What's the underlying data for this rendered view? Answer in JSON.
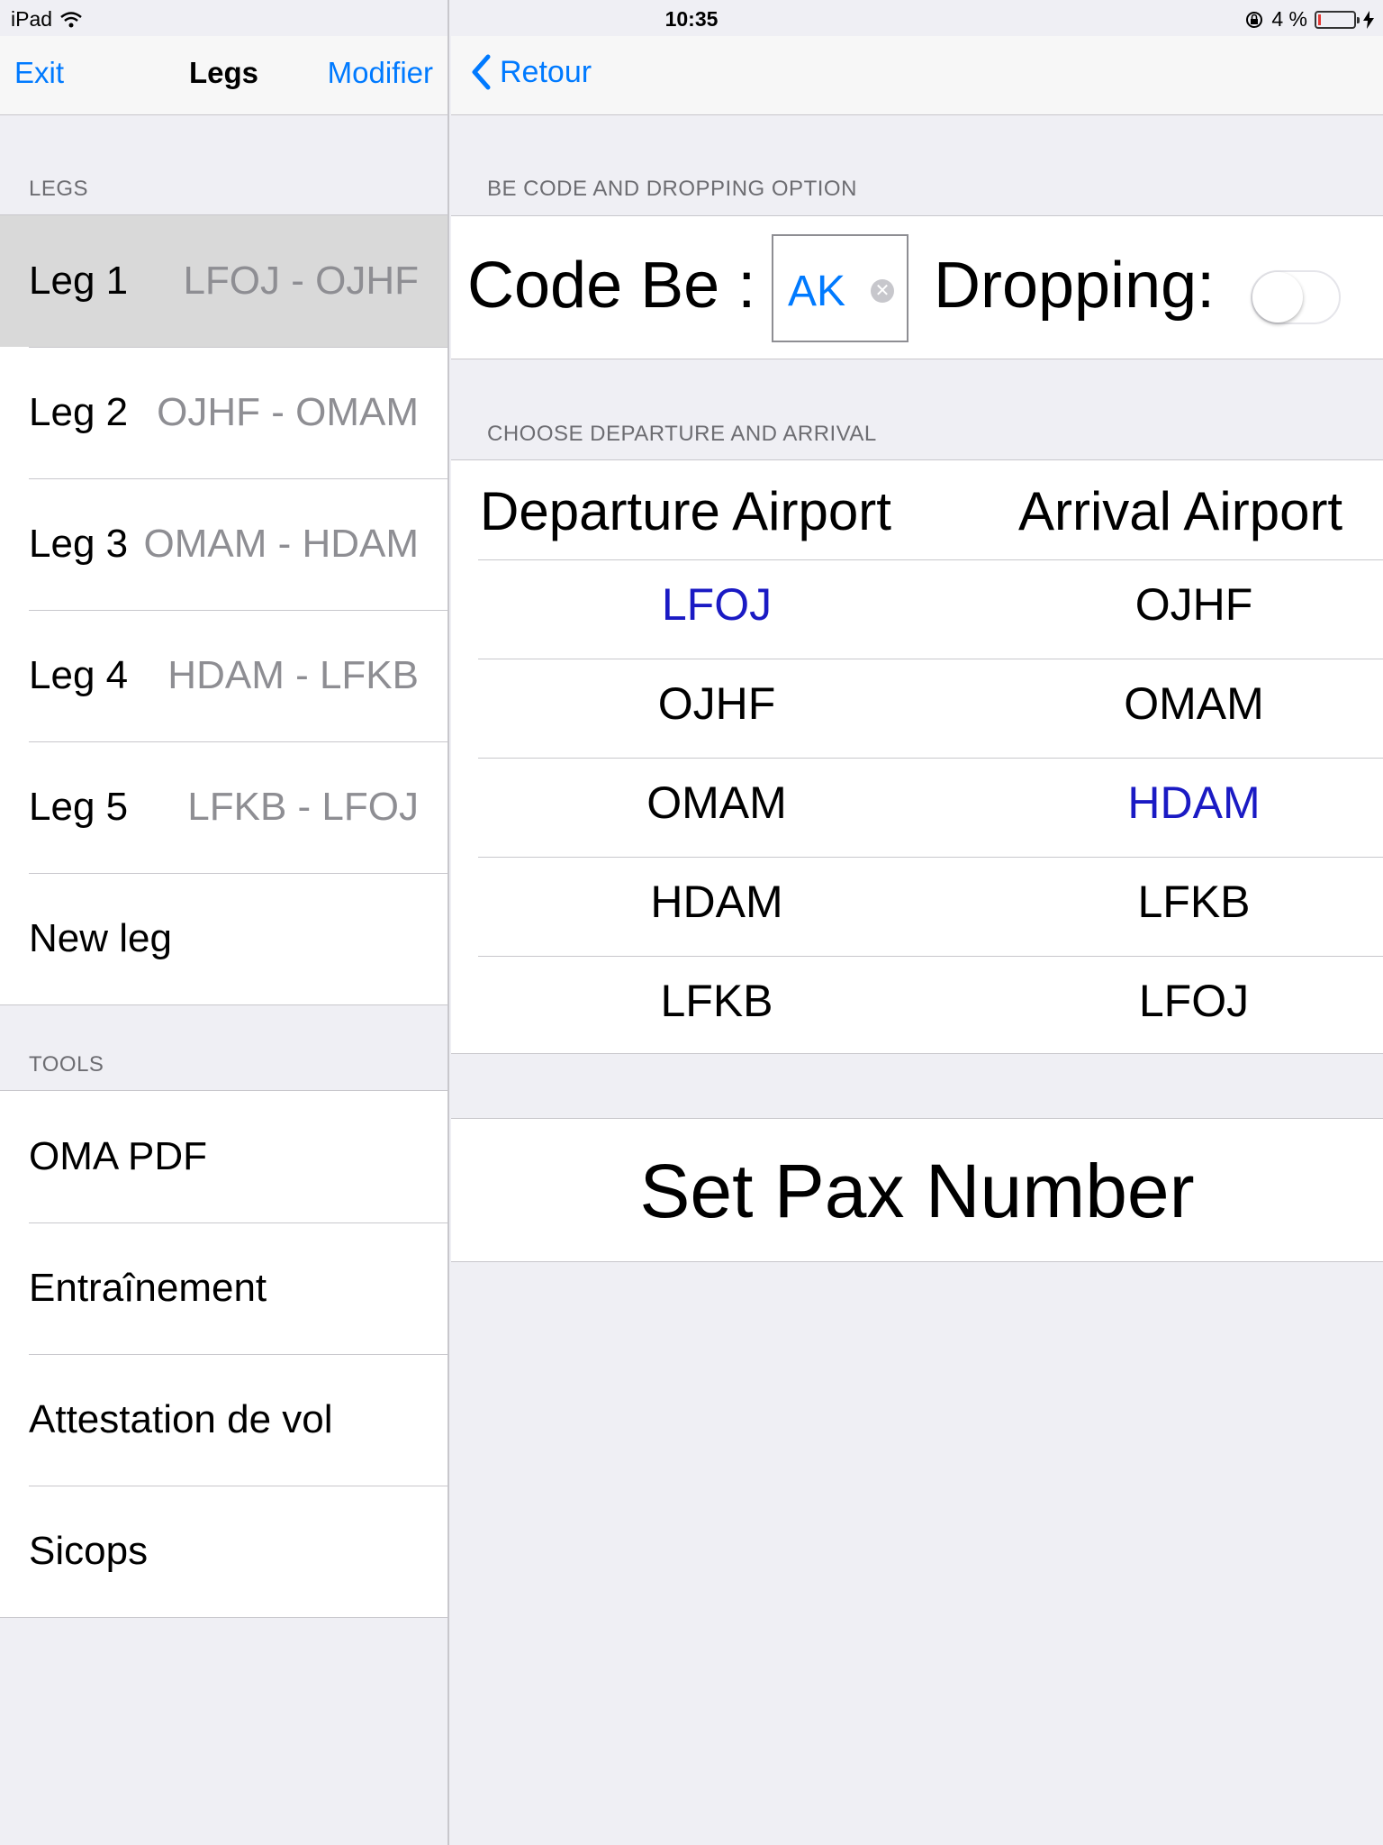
{
  "status_bar": {
    "device": "iPad",
    "time": "10:35",
    "battery_text": "4 %"
  },
  "master": {
    "nav": {
      "left_button": "Exit",
      "title": "Legs",
      "right_button": "Modifier"
    },
    "legs_header": "LEGS",
    "legs": [
      {
        "name": "Leg 1",
        "route": "LFOJ - OJHF",
        "selected": true
      },
      {
        "name": "Leg 2",
        "route": "OJHF - OMAM",
        "selected": false
      },
      {
        "name": "Leg 3",
        "route": "OMAM - HDAM",
        "selected": false
      },
      {
        "name": "Leg 4",
        "route": "HDAM - LFKB",
        "selected": false
      },
      {
        "name": "Leg 5",
        "route": "LFKB - LFOJ",
        "selected": false
      }
    ],
    "new_leg": "New leg",
    "tools_header": "TOOLS",
    "tools": [
      "OMA PDF",
      "Entraînement",
      "Attestation de vol",
      "Sicops"
    ]
  },
  "detail": {
    "nav": {
      "back_button": "Retour"
    },
    "be_section_header": "BE CODE AND DROPPING OPTION",
    "code_be_label": "Code Be :",
    "code_be_value": "AK",
    "dropping_label": "Dropping:",
    "dropping_on": false,
    "airports_section_header": "CHOOSE DEPARTURE AND ARRIVAL",
    "departure_header": "Departure Airport",
    "arrival_header": "Arrival Airport",
    "airport_rows": [
      {
        "departure": "LFOJ",
        "arrival": "OJHF"
      },
      {
        "departure": "OJHF",
        "arrival": "OMAM"
      },
      {
        "departure": "OMAM",
        "arrival": "HDAM"
      },
      {
        "departure": "HDAM",
        "arrival": "LFKB"
      },
      {
        "departure": "LFKB",
        "arrival": "LFOJ"
      }
    ],
    "pax_button": "Set Pax Number"
  },
  "colors": {
    "accent": "#007aff",
    "highlight": "#1a1ac4",
    "selected_row": "#d9d9d9",
    "background": "#efeff4"
  }
}
